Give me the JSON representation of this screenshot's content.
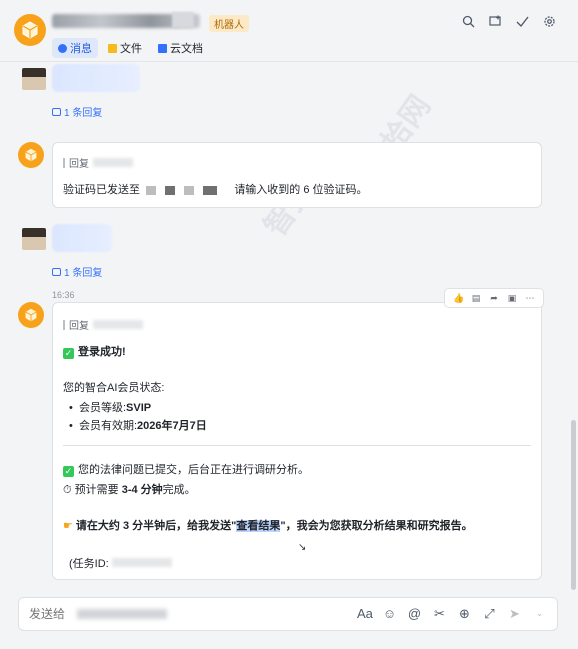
{
  "header": {
    "bot_tag": "机器人",
    "tabs": [
      {
        "label": "消息",
        "active": true,
        "icon": "chat-icon"
      },
      {
        "label": "文件",
        "active": false,
        "icon": "folder-icon"
      },
      {
        "label": "云文档",
        "active": false,
        "icon": "doc-icon"
      }
    ],
    "icons": [
      "search-icon",
      "add-chat-icon",
      "done-icon",
      "settings-icon"
    ]
  },
  "feed": {
    "reply_count_1": "1 条回复",
    "card1": {
      "quote_label": "回复",
      "text_prefix": "验证码已发送至",
      "text_suffix": "请输入收到的 6 位验证码。"
    },
    "reply_count_2": "1 条回复",
    "time": "16:36",
    "card2": {
      "quote_label": "回复",
      "login_ok": "登录成功!",
      "status_title": "您的智合AI会员状态:",
      "level_label": "会员等级:",
      "level_value": "SVIP",
      "expiry_label": "会员有效期:",
      "expiry_value": "2026年7月7日",
      "submitted": "您的法律问题已提交，后台正在进行调研分析。",
      "eta_prefix": "预计需要 ",
      "eta_value": "3-4 分钟",
      "eta_suffix": "完成。",
      "instruct_a": "请在大约 3 分半钟后，给我发送\"",
      "instruct_hl": "查看结果",
      "instruct_b": "\"，我会为您获取分析结果和研究报告。",
      "task_label": "(任务ID:"
    }
  },
  "composer": {
    "placeholder": "发送给",
    "icons": [
      "font-icon",
      "emoji-icon",
      "mention-icon",
      "scissors-icon",
      "plus-icon",
      "expand-icon",
      "send-icon",
      "chevron-down-icon"
    ]
  },
  "colors": {
    "accent": "#3370ff",
    "bot_avatar": "#f7a21a",
    "check": "#34c759"
  }
}
